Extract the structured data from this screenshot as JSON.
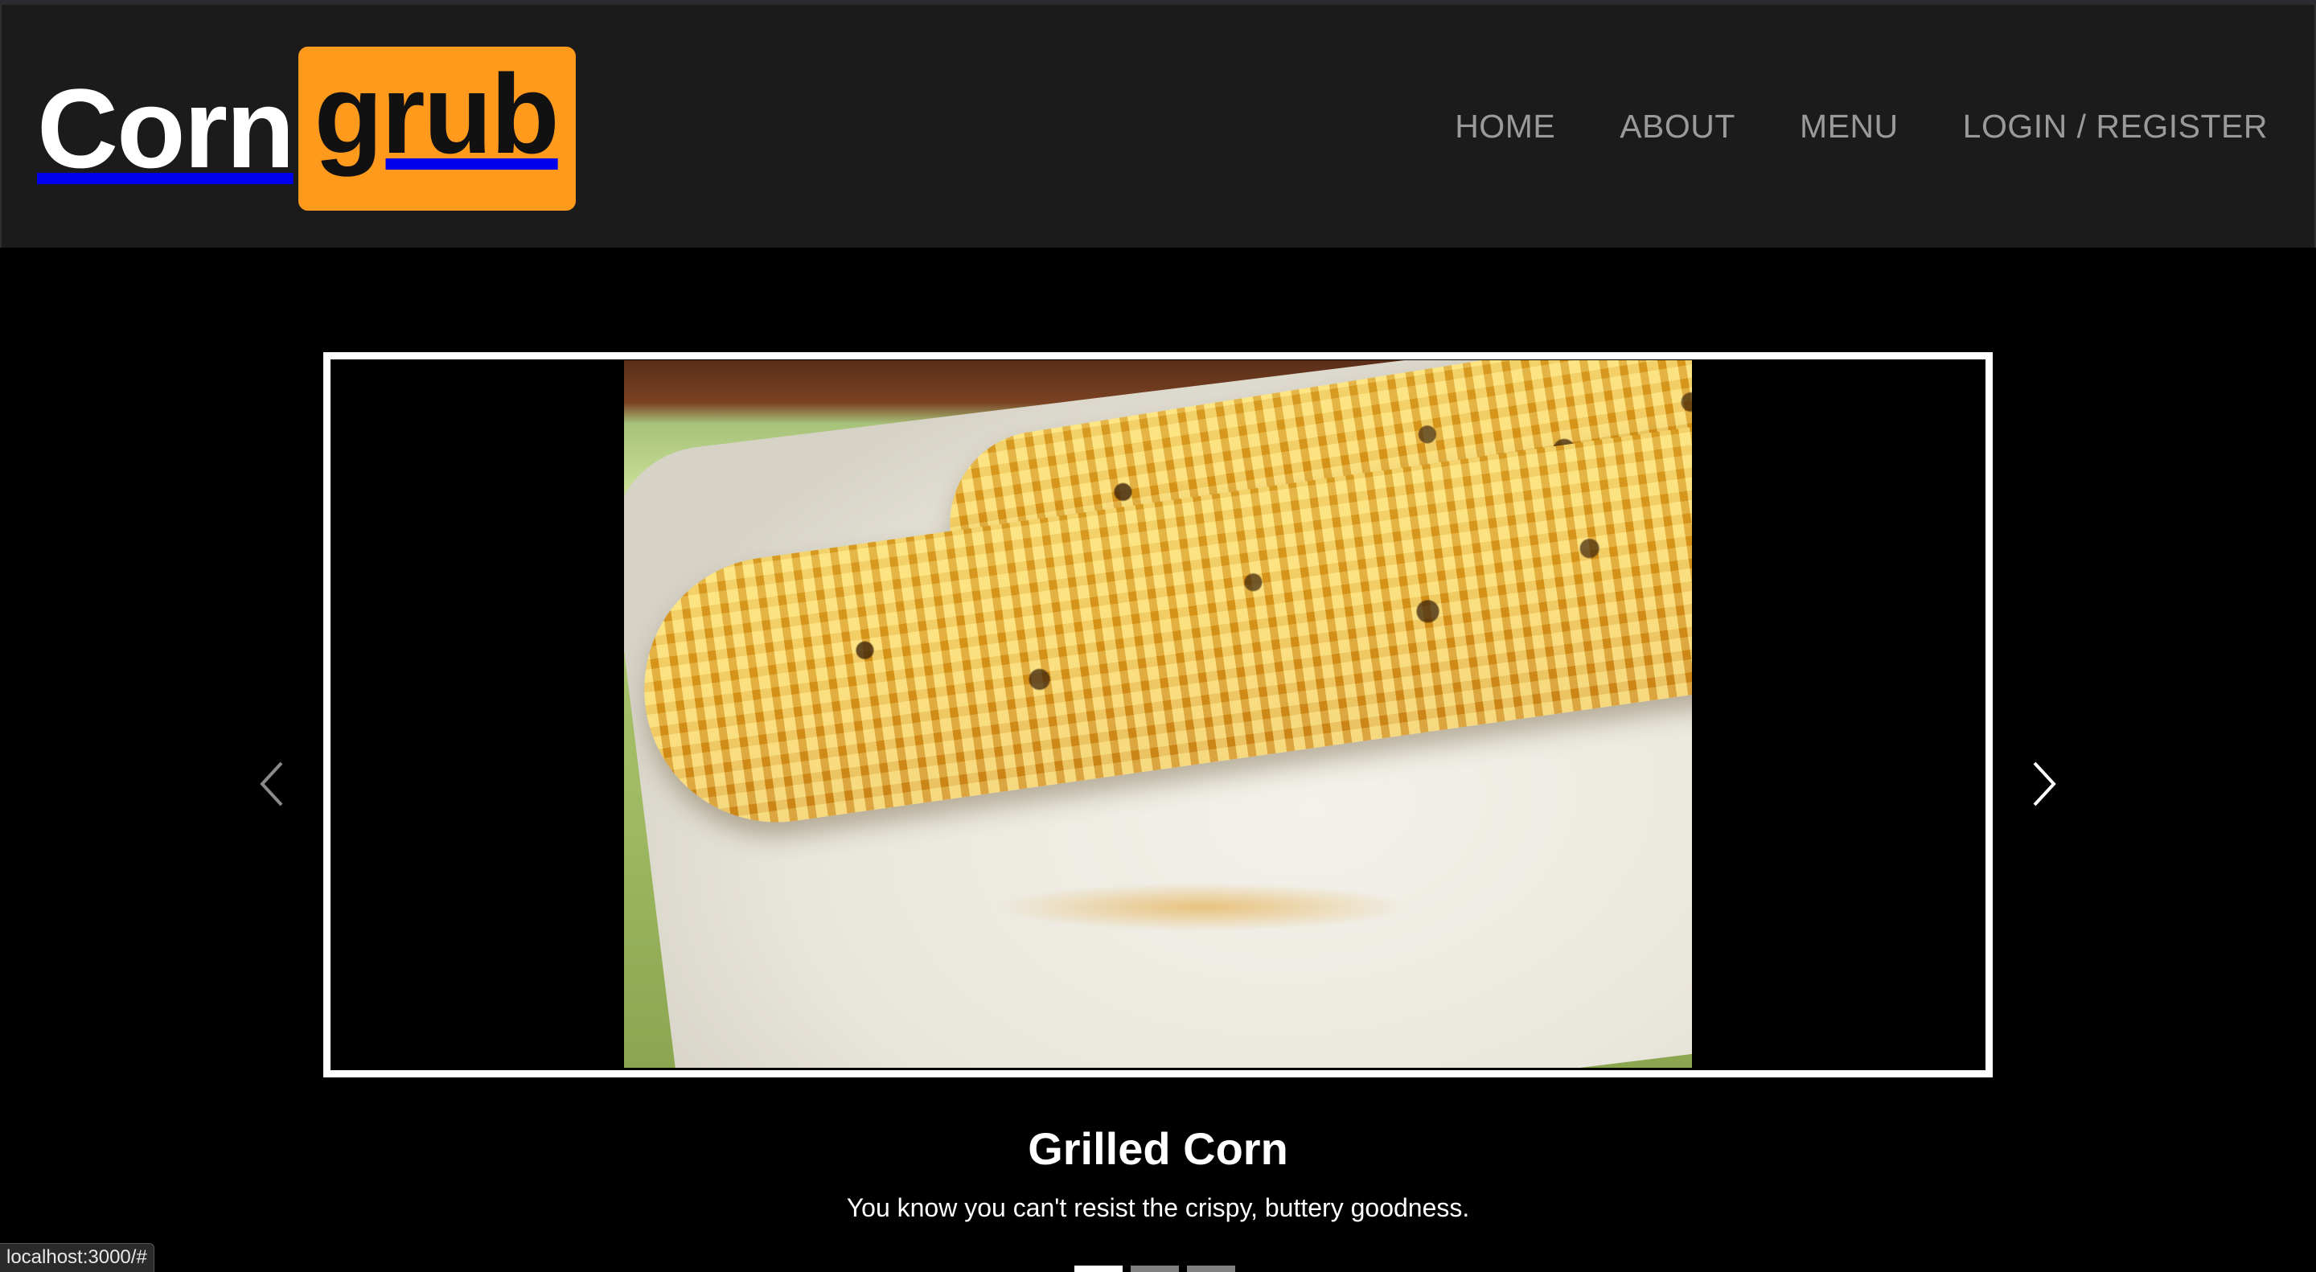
{
  "brand": {
    "part1": "Corn",
    "part2": "grub",
    "accent_color": "#ff9a1d"
  },
  "nav": {
    "items": [
      {
        "label": "HOME"
      },
      {
        "label": "ABOUT"
      },
      {
        "label": "MENU"
      },
      {
        "label": "LOGIN / REGISTER"
      }
    ]
  },
  "carousel": {
    "slide": {
      "image_subject": "grilled corn on the cob on a white plate",
      "caption_title": "Grilled Corn",
      "caption_text": "You know you can't resist the crispy, buttery goodness."
    },
    "prev_icon": "chevron-left-icon",
    "next_icon": "chevron-right-icon",
    "indicator_count": 3,
    "active_index": 0
  },
  "status_bar": {
    "url": "localhost:3000/#"
  }
}
